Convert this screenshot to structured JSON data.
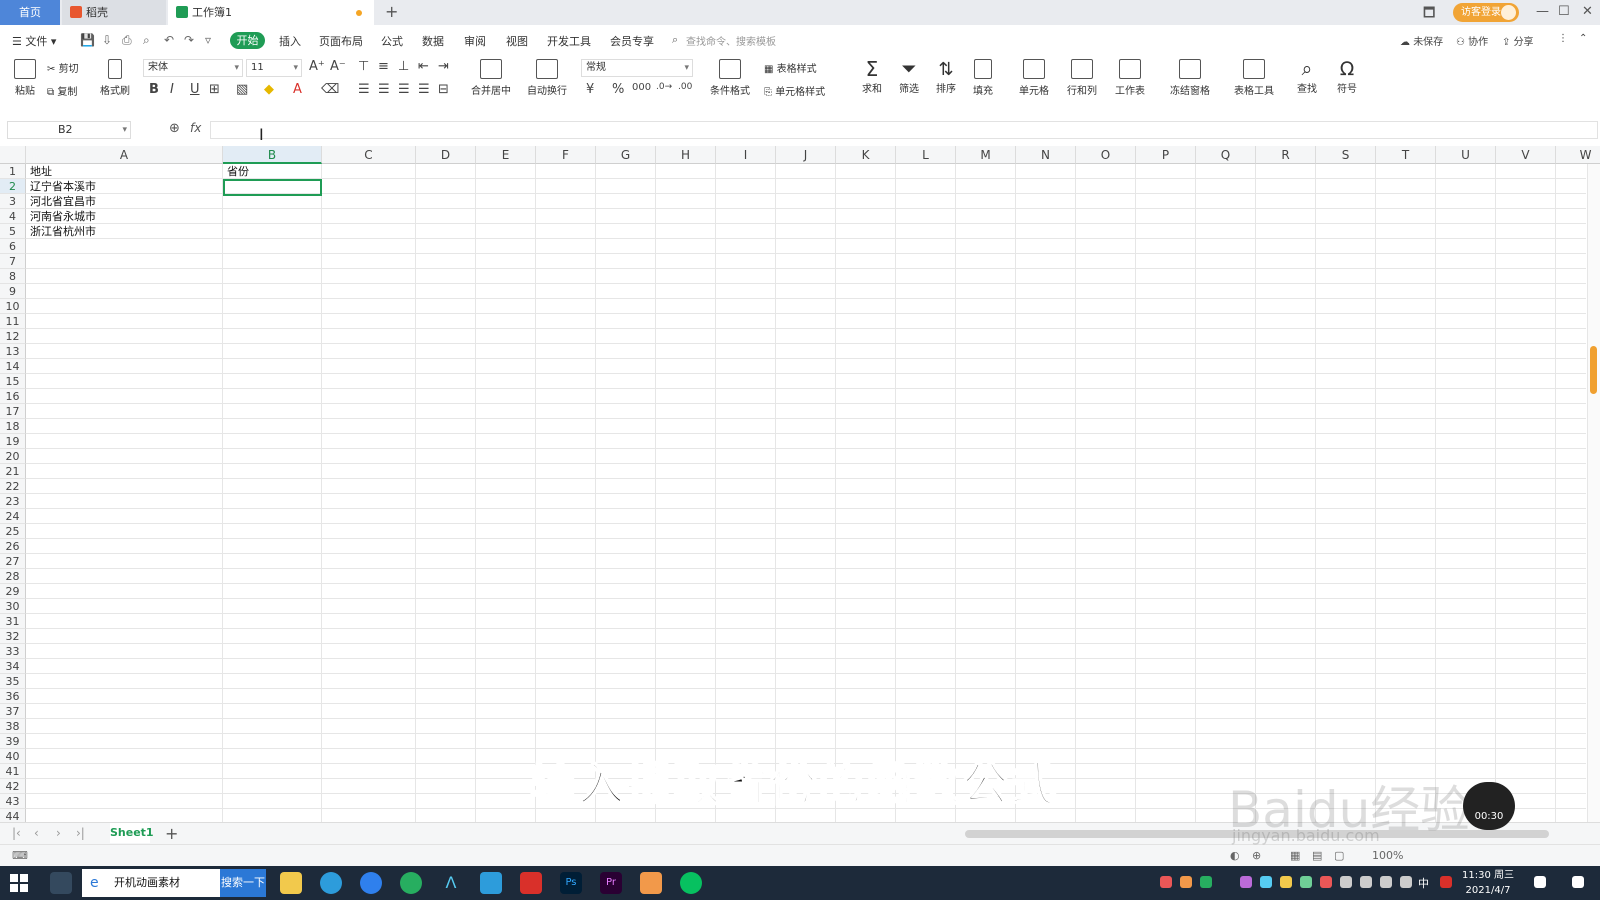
{
  "tabbar": {
    "home": "首页",
    "docer": "稻壳",
    "workbook": "工作簿1",
    "login": "访客登录",
    "win_restore": "🗖",
    "win_min": "—",
    "win_max": "☐",
    "win_close": "✕"
  },
  "menubar": {
    "file": "文件",
    "items": [
      "开始",
      "插入",
      "页面布局",
      "公式",
      "数据",
      "审阅",
      "视图",
      "开发工具",
      "会员专享"
    ],
    "search_hint": "查找命令、搜索模板",
    "unsaved": "未保存",
    "collab": "协作",
    "share": "分享"
  },
  "toolbar": {
    "paste": "粘贴",
    "cut": "剪切",
    "copy": "复制",
    "format_painter": "格式刷",
    "font": "宋体",
    "font_size": "11",
    "merge_center": "合并居中",
    "wrap": "自动换行",
    "number_format": "常规",
    "cond_format": "条件格式",
    "table_style": "表格样式",
    "cell_style": "单元格样式",
    "sum": "求和",
    "filter": "筛选",
    "sort": "排序",
    "fill": "填充",
    "cell": "单元格",
    "row_col": "行和列",
    "sheet": "工作表",
    "freeze": "冻结窗格",
    "table_tools": "表格工具",
    "find": "查找",
    "symbol": "符号"
  },
  "formula_bar": {
    "name_box": "B2",
    "fx": "fx",
    "value": ""
  },
  "columns": [
    "A",
    "B",
    "C",
    "D",
    "E",
    "F",
    "G",
    "H",
    "I",
    "J",
    "K",
    "L",
    "M",
    "N",
    "O",
    "P",
    "Q",
    "R",
    "S",
    "T",
    "U",
    "V",
    "W"
  ],
  "rows": [
    "1",
    "2",
    "3",
    "4",
    "5",
    "6",
    "7",
    "8",
    "9",
    "10",
    "11",
    "12",
    "13",
    "14",
    "15",
    "16",
    "17",
    "18",
    "19",
    "20",
    "21",
    "22",
    "23",
    "24",
    "25",
    "26",
    "27",
    "28",
    "29",
    "30",
    "31",
    "32",
    "33",
    "34",
    "35",
    "36",
    "37",
    "38",
    "39",
    "40",
    "41",
    "42",
    "43",
    "44"
  ],
  "cells": {
    "A1": "地址",
    "B1": "省份",
    "A2": "辽宁省本溪市",
    "A3": "河北省宜昌市",
    "A4": "河南省永城市",
    "A5": "浙江省杭州市"
  },
  "selected_cell": "B2",
  "sheet_tabs": [
    "Sheet1"
  ],
  "status": {
    "zoom": "100%"
  },
  "taskbar": {
    "search_text": "开机动画素材",
    "search_button": "搜索一下",
    "time": "11:30 周三",
    "date": "2021/4/7",
    "ime": "中"
  },
  "overlay": {
    "subtitle": "输入提取省份的函数公式",
    "watermark": "Baidu经验",
    "watermark_url": "jingyan.baidu.com",
    "timer": "00:30"
  },
  "colors": {
    "accent_green": "#1f9c55",
    "tab_blue": "#4e86d9",
    "orange": "#f1a435"
  }
}
